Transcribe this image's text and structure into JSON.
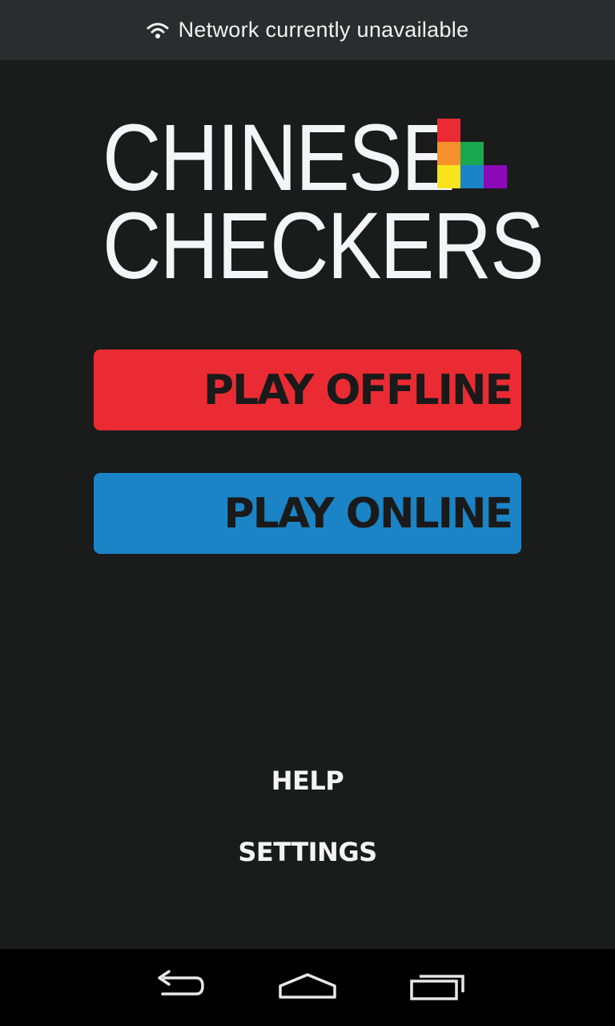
{
  "status_banner": {
    "icon": "wifi-icon",
    "text": "Network currently unavailable"
  },
  "logo": {
    "line1": "CHINESE",
    "line2": "CHECKERS",
    "block_colors": {
      "red": "#ea2b33",
      "orange": "#f5902a",
      "green": "#19a850",
      "yellow": "#f8e219",
      "blue": "#1a84c6",
      "purple": "#8b09b7"
    }
  },
  "main_menu": {
    "play_offline": {
      "label": "PLAY OFFLINE",
      "color": "#ea2b33"
    },
    "play_online": {
      "label": "PLAY ONLINE",
      "color": "#1a84c6"
    },
    "help": {
      "label": "HELP"
    },
    "settings": {
      "label": "SETTINGS"
    }
  },
  "nav_bar": {
    "back": "back-icon",
    "home": "home-icon",
    "recent": "recent-apps-icon"
  }
}
